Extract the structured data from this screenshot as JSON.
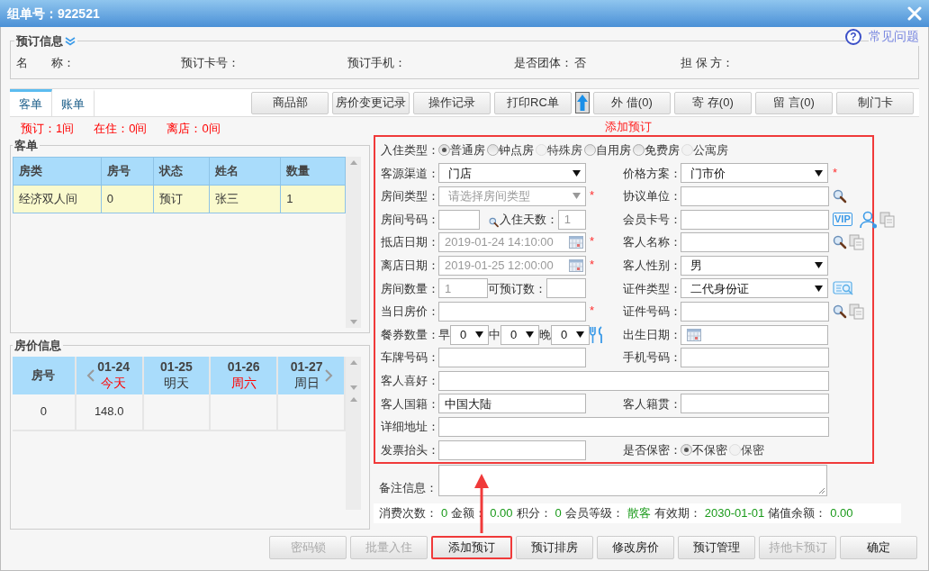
{
  "window": {
    "title": "组单号：922521"
  },
  "help": {
    "icon": "?",
    "label": "常见问题"
  },
  "booking_info": {
    "legend": "预订信息",
    "fields": [
      {
        "label": "名　　称："
      },
      {
        "label": "预订卡号："
      },
      {
        "label": "预订手机："
      },
      {
        "label": "是否团体：",
        "value": "否"
      },
      {
        "label": "担 保 方："
      }
    ]
  },
  "tabs": [
    {
      "label": "客单",
      "selected": true
    },
    {
      "label": "账单",
      "selected": false
    }
  ],
  "toolbar": [
    {
      "kind": "button",
      "label": "商品部"
    },
    {
      "kind": "button",
      "label": "房价变更记录"
    },
    {
      "kind": "button",
      "label": "操作记录"
    },
    {
      "kind": "button",
      "label": "打印RC单"
    },
    {
      "kind": "arrow"
    },
    {
      "kind": "button",
      "label": "外 借(0)"
    },
    {
      "kind": "button",
      "label": "寄 存(0)"
    },
    {
      "kind": "button",
      "label": "留 言(0)"
    },
    {
      "kind": "button",
      "label": "制门卡"
    }
  ],
  "room_counts": [
    "预订：1间",
    "在住：0间",
    "离店：0间"
  ],
  "guest_list": {
    "legend": "客单",
    "columns": [
      "房类",
      "房号",
      "状态",
      "姓名",
      "数量"
    ],
    "rows": [
      {
        "selected": true,
        "cells": [
          "经济双人间",
          "0",
          "预订",
          "张三",
          "1"
        ]
      }
    ]
  },
  "room_rates": {
    "legend": "房价信息",
    "first_column": "房号",
    "days": [
      {
        "date": "01-24",
        "label": "今天",
        "color": "#ff0000"
      },
      {
        "date": "01-25",
        "label": "明天",
        "color": "#333333"
      },
      {
        "date": "01-26",
        "label": "周六",
        "color": "#ff0000"
      },
      {
        "date": "01-27",
        "label": "周日",
        "color": "#333333"
      }
    ],
    "rows": [
      {
        "cells": [
          "0",
          "148.0"
        ]
      }
    ]
  },
  "callout": {
    "label": "添加预订"
  },
  "form": {
    "rows": [
      {
        "full": {
          "kind": "radios",
          "label": "入住类型：",
          "options": [
            {
              "label": "普通房",
              "selected": true,
              "disabled": false
            },
            {
              "label": "钟点房",
              "selected": false,
              "disabled": false
            },
            {
              "label": "特殊房",
              "selected": false,
              "disabled": true
            },
            {
              "label": "自用房",
              "selected": false,
              "disabled": false
            },
            {
              "label": "免费房",
              "selected": false,
              "disabled": false
            },
            {
              "label": "公寓房",
              "selected": false,
              "disabled": true
            }
          ]
        }
      },
      {
        "left": {
          "kind": "select",
          "label": "客源渠道：",
          "value": "门店"
        },
        "right": {
          "kind": "select",
          "label": "价格方案：",
          "value": "门市价",
          "mark": "*"
        }
      },
      {
        "left": {
          "kind": "select",
          "label": "房间类型：",
          "placeholder": "请选择房间类型",
          "disabled": true,
          "mark": "*"
        },
        "right": {
          "kind": "text",
          "label": "协议单位：",
          "actions": [
            {
              "kind": "lookup"
            }
          ]
        }
      },
      {
        "left": {
          "kind": "room",
          "label": "房间号码：",
          "sub_label": "入住天数：",
          "sub_value": "1",
          "disabled": true
        },
        "right": {
          "kind": "text",
          "label": "会员卡号：",
          "actions": [
            {
              "kind": "vip",
              "label": "VIP"
            },
            {
              "kind": "member"
            },
            {
              "kind": "copy"
            }
          ]
        }
      },
      {
        "left": {
          "kind": "date",
          "label": "抵店日期：",
          "value": "2019-01-24 14:10:00",
          "disabled": true,
          "mark": "*"
        },
        "right": {
          "kind": "text",
          "label": "客人名称：",
          "actions": [
            {
              "kind": "lookup"
            },
            {
              "kind": "copy"
            }
          ]
        }
      },
      {
        "left": {
          "kind": "date",
          "label": "离店日期：",
          "value": "2019-01-25 12:00:00",
          "disabled": true,
          "mark": "*"
        },
        "right": {
          "kind": "select",
          "label": "客人性别：",
          "value": "男"
        }
      },
      {
        "left": {
          "kind": "quantity",
          "label": "房间数量：",
          "value": "1",
          "sub_label": "可预订数：",
          "disabled": true
        },
        "right": {
          "kind": "select",
          "label": "证件类型：",
          "value": "二代身份证",
          "actions": [
            {
              "kind": "scan"
            }
          ]
        }
      },
      {
        "left": {
          "kind": "text",
          "label": "当日房价：",
          "mark": "*"
        },
        "right": {
          "kind": "text",
          "label": "证件号码：",
          "actions": [
            {
              "kind": "lookup"
            },
            {
              "kind": "copy"
            }
          ]
        }
      },
      {
        "left": {
          "kind": "meals",
          "label": "餐券数量：",
          "meals": [
            {
              "label": "早",
              "value": "0"
            },
            {
              "label": "中",
              "value": "0"
            },
            {
              "label": "晚",
              "value": "0"
            }
          ],
          "actions": [
            {
              "kind": "meal"
            }
          ]
        },
        "right": {
          "kind": "date",
          "label": "出生日期："
        }
      },
      {
        "left": {
          "kind": "text",
          "label": "车牌号码："
        },
        "right": {
          "kind": "text",
          "label": "手机号码："
        }
      },
      {
        "full": {
          "kind": "text",
          "label": "客人喜好："
        }
      },
      {
        "left": {
          "kind": "text",
          "label": "客人国籍：",
          "value": "中国大陆"
        },
        "right": {
          "kind": "text",
          "label": "客人籍贯："
        }
      },
      {
        "full": {
          "kind": "text",
          "label": "详细地址："
        }
      },
      {
        "left": {
          "kind": "text",
          "label": "发票抬头："
        },
        "right": {
          "kind": "radios",
          "label": "是否保密：",
          "options": [
            {
              "label": "不保密",
              "selected": true,
              "disabled": false
            },
            {
              "label": "保密",
              "selected": false,
              "disabled": true
            }
          ]
        }
      }
    ]
  },
  "remarks": {
    "label": "备注信息："
  },
  "member_stats": [
    {
      "label": "消费次数：",
      "value": "0"
    },
    {
      "label": "金额：",
      "value": "0.00"
    },
    {
      "label": "积分：",
      "value": "0"
    },
    {
      "label": "会员等级：",
      "value": "散客"
    },
    {
      "label": "有效期：",
      "value": "2030-01-01"
    },
    {
      "label": "储值余额：",
      "value": "0.00"
    }
  ],
  "footer_buttons": [
    {
      "label": "密码锁",
      "disabled": true,
      "highlighted": false
    },
    {
      "label": "批量入住",
      "disabled": true,
      "highlighted": false
    },
    {
      "label": "添加预订",
      "disabled": false,
      "highlighted": true
    },
    {
      "label": "预订排房",
      "disabled": false,
      "highlighted": false
    },
    {
      "label": "修改房价",
      "disabled": false,
      "highlighted": false
    },
    {
      "label": "预订管理",
      "disabled": false,
      "highlighted": false
    },
    {
      "label": "持他卡预订",
      "disabled": true,
      "highlighted": false
    },
    {
      "label": "确定",
      "disabled": false,
      "highlighted": false
    }
  ]
}
